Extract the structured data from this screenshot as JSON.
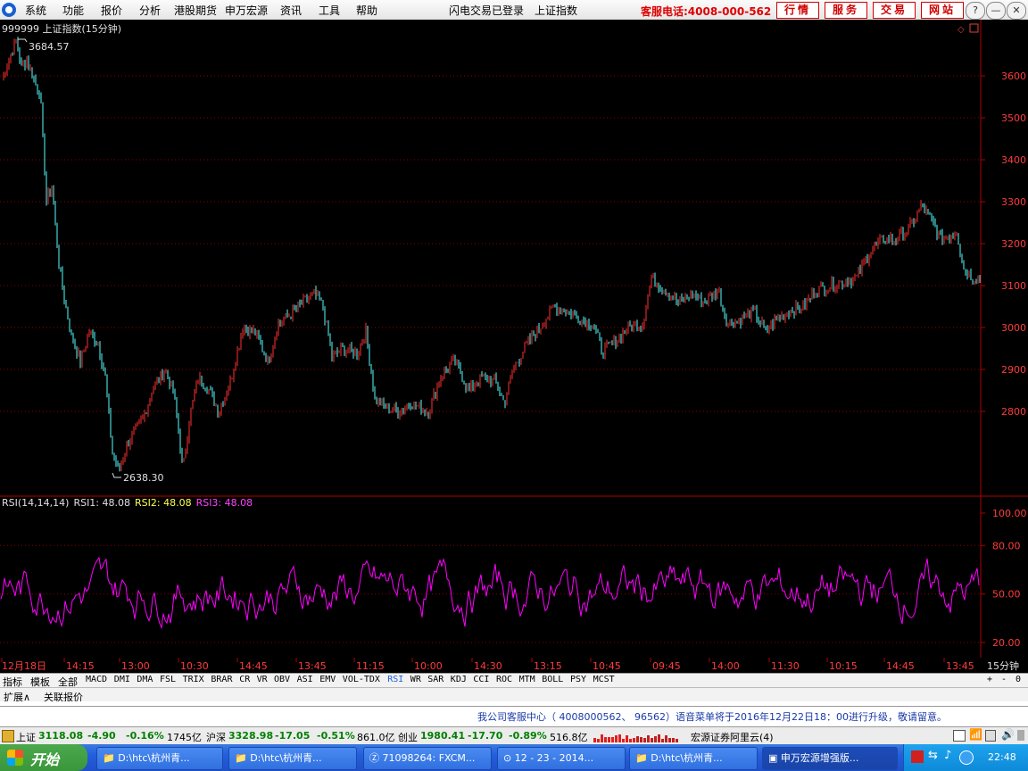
{
  "menubar": {
    "items": [
      "系统",
      "功能",
      "报价",
      "分析",
      "港股期货",
      "申万宏源",
      "资讯",
      "工具",
      "帮助"
    ],
    "login_status": "闪电交易已登录",
    "current_view": "上证指数",
    "hotline": "客服电话:4008-000-562",
    "buttons": [
      "行情",
      "服务",
      "交易",
      "网站"
    ]
  },
  "window_controls": [
    "?",
    "—",
    "❐",
    "✕"
  ],
  "main_chart": {
    "title": "999999 上证指数(15分钟)",
    "high_label": "3684.57",
    "low_label": "2638.30",
    "y_ticks": [
      "3600",
      "3500",
      "3400",
      "3300",
      "3200",
      "3100",
      "3000",
      "2900",
      "2800"
    ]
  },
  "indicator": {
    "label": "RSI(14,14,14)",
    "rsi1": "RSI1: 48.08",
    "rsi2": "RSI2: 48.08",
    "rsi3": "RSI3: 48.08",
    "y_ticks": [
      "100.00",
      "80.00",
      "50.00",
      "20.00"
    ]
  },
  "time_axis": {
    "labels": [
      "12月18日",
      "14:15",
      "13:00",
      "10:30",
      "14:45",
      "13:45",
      "11:15",
      "10:00",
      "14:30",
      "13:15",
      "10:45",
      "09:45",
      "14:00",
      "11:30",
      "10:15",
      "14:45",
      "13:45"
    ],
    "period": "15分钟"
  },
  "indicator_tabs": [
    "指标",
    "模板",
    "全部",
    "MACD",
    "DMI",
    "DMA",
    "FSL",
    "TRIX",
    "BRAR",
    "CR",
    "VR",
    "OBV",
    "ASI",
    "EMV",
    "VOL-TDX",
    "RSI",
    "WR",
    "SAR",
    "KDJ",
    "CCI",
    "ROC",
    "MTM",
    "BOLL",
    "PSY",
    "MCST"
  ],
  "tab_controls": [
    "+",
    "-",
    "0"
  ],
  "sub_tabs": [
    "扩展∧",
    "关联报价"
  ],
  "notice": "我公司客服中心（ 4008000562、 96562）语音菜单将于2016年12月22日18：00进行升级，敬请留意。",
  "statusbar": {
    "sh_name": "上证",
    "sh_value": "3118.08",
    "sh_change": "-4.90",
    "sh_pct": "-0.16%",
    "sh_amount": "1745亿",
    "hs_name": "沪深",
    "hs_value": "3328.98",
    "hs_change": "-17.05",
    "hs_pct": "-0.51%",
    "hs_amount": "861.0亿",
    "cy_name": "创业",
    "cy_value": "1980.41",
    "cy_change": "-17.70",
    "cy_pct": "-0.89%",
    "cy_amount": "516.8亿",
    "server": "宏源证券阿里云(4)"
  },
  "taskbar": {
    "start_label": "开始",
    "tasks": [
      "D:\\htc\\杭州青...",
      "D:\\htc\\杭州青...",
      "71098264: FXCM...",
      "12 - 23 - 2014...",
      "D:\\htc\\杭州青...",
      "申万宏源增强版..."
    ],
    "clock": "22:48"
  },
  "colors": {
    "up": "#ff3030",
    "down": "#54ffff",
    "rsi": "#ff00ff",
    "grid": "#8b0000",
    "axis_text": "#ff3c3c"
  }
}
